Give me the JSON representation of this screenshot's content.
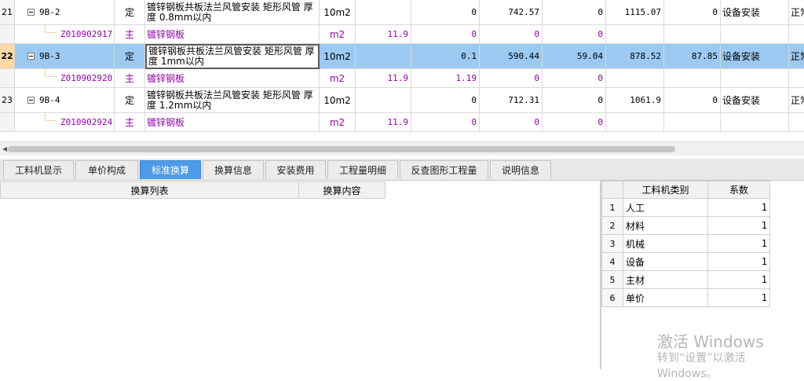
{
  "grid": {
    "rows": [
      {
        "no": "21",
        "code": "9B-2",
        "type": "定",
        "name": "镀锌钢板共板法兰风管安装 矩形风管 厚度 0.8mm以内",
        "unit": "10m2",
        "qty": "",
        "v1": "0",
        "v2": "742.57",
        "v3": "0",
        "v4": "1115.07",
        "v5": "0",
        "cat": "设备安装",
        "last": "正常"
      },
      {
        "sub": true,
        "code": "Z010902917",
        "type": "主",
        "name": "镀锌钢板",
        "unit": "m2",
        "qty": "11.9",
        "v1": "0",
        "v2": "0",
        "v3": "0",
        "v4": "",
        "v5": "",
        "cat": "",
        "last": ""
      },
      {
        "no": "22",
        "selected": true,
        "code": "9B-3",
        "type": "定",
        "name": "镀锌钢板共板法兰风管安装 矩形风管 厚度 1mm以内",
        "unit": "10m2",
        "qty": "",
        "v1": "0.1",
        "v2": "590.44",
        "v3": "59.04",
        "v4": "878.52",
        "v5": "87.85",
        "cat": "设备安装",
        "last": "正常"
      },
      {
        "sub": true,
        "code": "Z010902920",
        "type": "主",
        "name": "镀锌钢板",
        "unit": "m2",
        "qty": "11.9",
        "v1": "1.19",
        "v2": "0",
        "v3": "0",
        "v4": "",
        "v5": "",
        "cat": "",
        "last": ""
      },
      {
        "no": "23",
        "code": "9B-4",
        "type": "定",
        "name": "镀锌钢板共板法兰风管安装 矩形风管 厚度 1.2mm以内",
        "unit": "10m2",
        "qty": "",
        "v1": "0",
        "v2": "712.31",
        "v3": "0",
        "v4": "1061.9",
        "v5": "0",
        "cat": "设备安装",
        "last": "正常"
      },
      {
        "sub": true,
        "code": "Z010902924",
        "type": "主",
        "name": "镀锌钢板",
        "unit": "m2",
        "qty": "11.9",
        "v1": "0",
        "v2": "0",
        "v3": "0",
        "v4": "",
        "v5": "",
        "cat": "",
        "last": ""
      }
    ]
  },
  "tabs": [
    {
      "label": "工料机显示"
    },
    {
      "label": "单价构成"
    },
    {
      "label": "标准换算",
      "active": true
    },
    {
      "label": "换算信息"
    },
    {
      "label": "安装费用"
    },
    {
      "label": "工程量明细"
    },
    {
      "label": "反查图形工程量"
    },
    {
      "label": "说明信息"
    }
  ],
  "conversion_panel": {
    "col_list": "换算列表",
    "col_content": "换算内容"
  },
  "factor_table": {
    "col_category": "工料机类别",
    "col_factor": "系数",
    "rows": [
      {
        "idx": "1",
        "category": "人工",
        "factor": "1"
      },
      {
        "idx": "2",
        "category": "材料",
        "factor": "1"
      },
      {
        "idx": "3",
        "category": "机械",
        "factor": "1"
      },
      {
        "idx": "4",
        "category": "设备",
        "factor": "1"
      },
      {
        "idx": "5",
        "category": "主材",
        "factor": "1"
      },
      {
        "idx": "6",
        "category": "单价",
        "factor": "1"
      }
    ]
  },
  "watermark": {
    "line1": "激活 Windows",
    "line2": "转到“设置”以激活 Windows。"
  },
  "colors": {
    "selected_row": "#9cc9f2",
    "active_tab": "#4d9be6",
    "subitem_text": "#9400a8"
  }
}
